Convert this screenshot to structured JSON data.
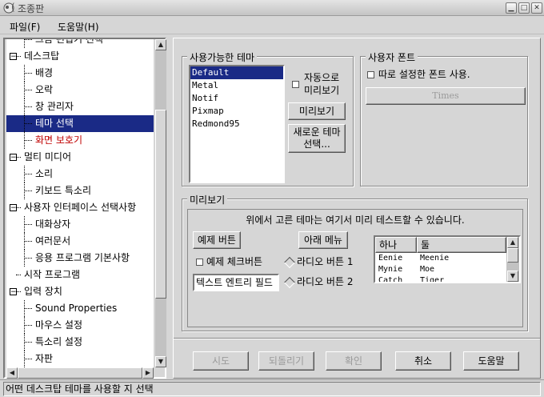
{
  "window": {
    "title": "조종판"
  },
  "menu": {
    "file": "파일(F)",
    "help": "도움말(H)"
  },
  "tree": {
    "items": [
      {
        "label": "그놈 편집기 선택",
        "level": 1,
        "expander": ""
      },
      {
        "label": "데스크탑",
        "level": 0,
        "expander": "-"
      },
      {
        "label": "배경",
        "level": 1,
        "expander": ""
      },
      {
        "label": "오락",
        "level": 1,
        "expander": ""
      },
      {
        "label": "창 관리자",
        "level": 1,
        "expander": ""
      },
      {
        "label": "테마 선택",
        "level": 1,
        "expander": "",
        "selected": true
      },
      {
        "label": "화면 보호기",
        "level": 1,
        "expander": "",
        "red": true
      },
      {
        "label": "멀티 미디어",
        "level": 0,
        "expander": "-"
      },
      {
        "label": "소리",
        "level": 1,
        "expander": ""
      },
      {
        "label": "키보드 특소리",
        "level": 1,
        "expander": ""
      },
      {
        "label": "사용자 인터페이스 선택사항",
        "level": 0,
        "expander": "-"
      },
      {
        "label": "대화상자",
        "level": 1,
        "expander": ""
      },
      {
        "label": "여러문서",
        "level": 1,
        "expander": ""
      },
      {
        "label": "응용 프로그램 기본사항",
        "level": 1,
        "expander": ""
      },
      {
        "label": "시작 프로그램",
        "level": 0,
        "expander": ""
      },
      {
        "label": "입력 장치",
        "level": 0,
        "expander": "-"
      },
      {
        "label": "Sound Properties",
        "level": 1,
        "expander": ""
      },
      {
        "label": "마우스 설정",
        "level": 1,
        "expander": ""
      },
      {
        "label": "특소리 설정",
        "level": 1,
        "expander": ""
      },
      {
        "label": "자판",
        "level": 1,
        "expander": ""
      }
    ]
  },
  "themes": {
    "group_title": "사용가능한 테마",
    "list": [
      "Default",
      "Metal",
      "Notif",
      "Pixmap",
      "Redmond95"
    ],
    "selected": "Default",
    "auto_preview_line1": "자동으로",
    "auto_preview_line2": "미리보기",
    "preview_button": "미리보기",
    "new_theme_line1": "새로운 테마",
    "new_theme_line2": "선택..."
  },
  "font": {
    "group_title": "사용자 폰트",
    "use_custom_label": "따로 설정한 폰트 사용.",
    "font_button": "Times"
  },
  "preview": {
    "group_title": "미리보기",
    "info": "위에서 고른 테마는 여기서 미리 테스트할 수 있습니다.",
    "example_button": "예제 버튼",
    "menu_button": "아래 메뉴",
    "check_label": "예제 체크버튼",
    "radio1": "라디오 버튼 1",
    "radio2": "라디오 버튼 2",
    "entry_value": "텍스트 엔트리 필드",
    "table_headers": [
      "하나",
      "둘"
    ],
    "table_rows": [
      [
        "Eenie",
        "Meenie"
      ],
      [
        "Mynie",
        "Moe"
      ],
      [
        "Catch",
        "Tiger"
      ]
    ]
  },
  "buttons": {
    "try": "시도",
    "revert": "되돌리기",
    "ok": "확인",
    "cancel": "취소",
    "help": "도움말"
  },
  "status": {
    "text": "어떤 데스크탑 테마를 사용할 지 선택"
  }
}
